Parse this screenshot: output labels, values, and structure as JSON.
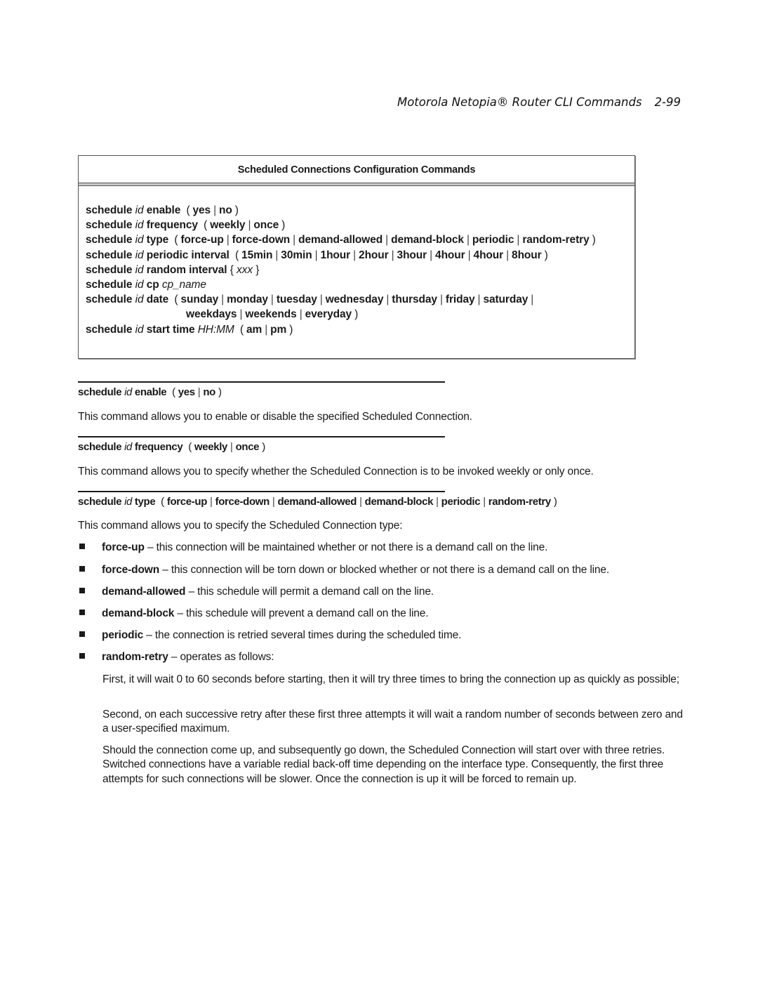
{
  "header": {
    "title": "Motorola Netopia® Router CLI Commands",
    "page_number": "2-99"
  },
  "command_box": {
    "title": "Scheduled Connections Configuration Commands",
    "lines": {
      "enable": {
        "kw": "schedule",
        "arg": "id",
        "cmd": "enable",
        "opts": [
          "yes",
          "no"
        ]
      },
      "frequency": {
        "kw": "schedule",
        "arg": "id",
        "cmd": "frequency",
        "opts": [
          "weekly",
          "once"
        ]
      },
      "type": {
        "kw": "schedule",
        "arg": "id",
        "cmd": "type",
        "opts": [
          "force-up",
          "force-down",
          "demand-allowed",
          "demand-block",
          "periodic",
          "random-retry"
        ]
      },
      "periodic": {
        "kw": "schedule",
        "arg": "id",
        "cmd": "periodic interval",
        "opts": [
          "15min",
          "30min",
          "1hour",
          "2hour",
          "3hour",
          "4hour",
          "4hour",
          "8hour"
        ]
      },
      "random": {
        "kw": "schedule",
        "arg": "id",
        "cmd": "random interval",
        "open": "{",
        "value": "xxx",
        "close": "}"
      },
      "cp": {
        "kw": "schedule",
        "arg": "id",
        "cmd": "cp",
        "value": "cp_name"
      },
      "date": {
        "kw": "schedule",
        "arg": "id",
        "cmd": "date",
        "opts_line1": [
          "sunday",
          "monday",
          "tuesday",
          "wednesday",
          "thursday",
          "friday",
          "saturday"
        ],
        "opts_line2": [
          "weekdays",
          "weekends",
          "everyday"
        ]
      },
      "start": {
        "kw": "schedule",
        "arg": "id",
        "cmd": "start time",
        "value": "HH:MM",
        "opts": [
          "am",
          "pm"
        ]
      }
    }
  },
  "sections": {
    "enable": {
      "heading": {
        "kw": "schedule",
        "arg": "id",
        "cmd": "enable",
        "opts": [
          "yes",
          "no"
        ]
      },
      "description": "This command allows you to enable or disable the specified Scheduled Connection."
    },
    "frequency": {
      "heading": {
        "kw": "schedule",
        "arg": "id",
        "cmd": "frequency",
        "opts": [
          "weekly",
          "once"
        ]
      },
      "description": "This command allows you to specify whether the Scheduled Connection is to be invoked weekly or only once."
    },
    "type": {
      "heading": {
        "kw": "schedule",
        "arg": "id",
        "cmd": "type",
        "opts": [
          "force-up",
          "force-down",
          "demand-allowed",
          "demand-block",
          "periodic",
          "random-retry"
        ]
      },
      "description": "This command allows you to specify the Scheduled Connection type:",
      "bullets": [
        {
          "term": "force-up",
          "text": " – this connection will be maintained whether or not there is a demand call on the line."
        },
        {
          "term": "force-down",
          "text": " – this connection will be torn down or blocked whether or not there is a demand call on the line."
        },
        {
          "term": "demand-allowed",
          "text": " – this schedule will permit a demand call on the line."
        },
        {
          "term": "demand-block",
          "text": " – this schedule will prevent a demand call on the line."
        },
        {
          "term": "periodic",
          "text": " – the connection is retried several times during the scheduled time."
        },
        {
          "term": "random-retry",
          "text": " – operates as follows:"
        }
      ],
      "random_retry_paragraphs": [
        "First, it will wait 0 to 60 seconds before starting, then it will try three times to bring the connection up as quickly as possible;",
        "Second, on each successive retry after these first three attempts it will wait a random number of seconds between zero and a user-specified maximum.",
        "Should the connection come up, and subsequently go down, the Scheduled Connection will start over with three retries. Switched connections have a variable redial back-off time depending on the interface type. Consequently, the first three attempts for such connections will be slower. Once the connection is up it will be forced to remain up."
      ]
    }
  }
}
